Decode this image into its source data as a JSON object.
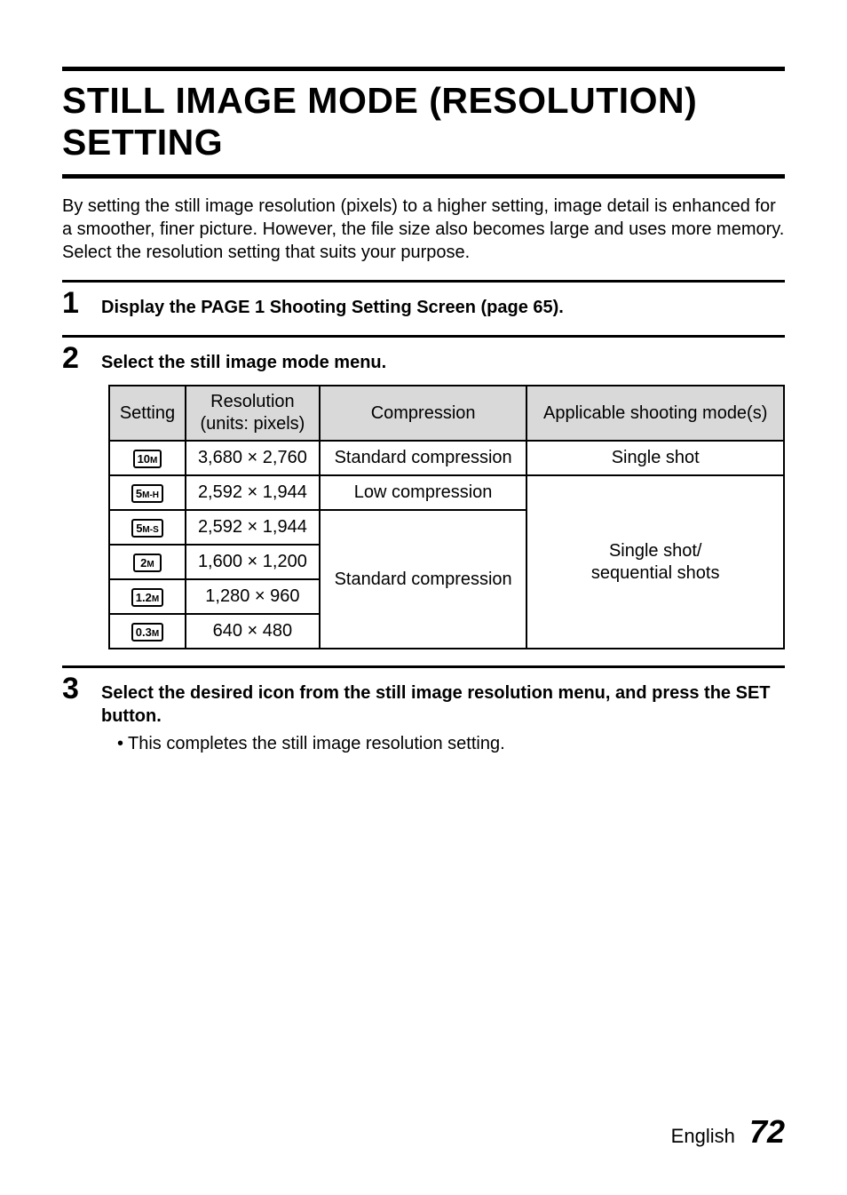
{
  "title": "STILL IMAGE MODE (RESOLUTION) SETTING",
  "intro": "By setting the still image resolution (pixels) to a higher setting, image detail is enhanced for a smoother, finer picture. However, the file size also becomes large and uses more memory. Select the resolution setting that suits your purpose.",
  "step1": {
    "number": "1",
    "heading": "Display the PAGE 1 Shooting Setting Screen (page 65)."
  },
  "step2": {
    "number": "2",
    "heading": "Select the still image mode menu.",
    "table": {
      "headers": {
        "setting": "Setting",
        "resolution": "Resolution\n(units: pixels)",
        "compression": "Compression",
        "modes": "Applicable shooting mode(s)"
      },
      "rows": [
        {
          "icon_main": "10",
          "icon_sub": "M",
          "resolution": "3,680 × 2,760",
          "compression": "Standard compression",
          "modes": "Single shot"
        },
        {
          "icon_main": "5",
          "icon_sub": "M-H",
          "resolution": "2,592 × 1,944",
          "compression": "Low compression"
        },
        {
          "icon_main": "5",
          "icon_sub": "M-S",
          "resolution": "2,592 × 1,944"
        },
        {
          "icon_main": "2",
          "icon_sub": "M",
          "resolution": "1,600 × 1,200"
        },
        {
          "icon_main": "1.2",
          "icon_sub": "M",
          "resolution": "1,280 × 960"
        },
        {
          "icon_main": "0.3",
          "icon_sub": "M",
          "resolution": "640 × 480"
        }
      ],
      "std_compression": "Standard compression",
      "modes_multi": "Single shot/\nsequential shots"
    }
  },
  "step3": {
    "number": "3",
    "heading": "Select the desired icon from the still image resolution menu, and press the SET button.",
    "sub_bullet": "•",
    "sub_text": "This completes the still image resolution setting."
  },
  "footer": {
    "lang": "English",
    "page": "72"
  }
}
